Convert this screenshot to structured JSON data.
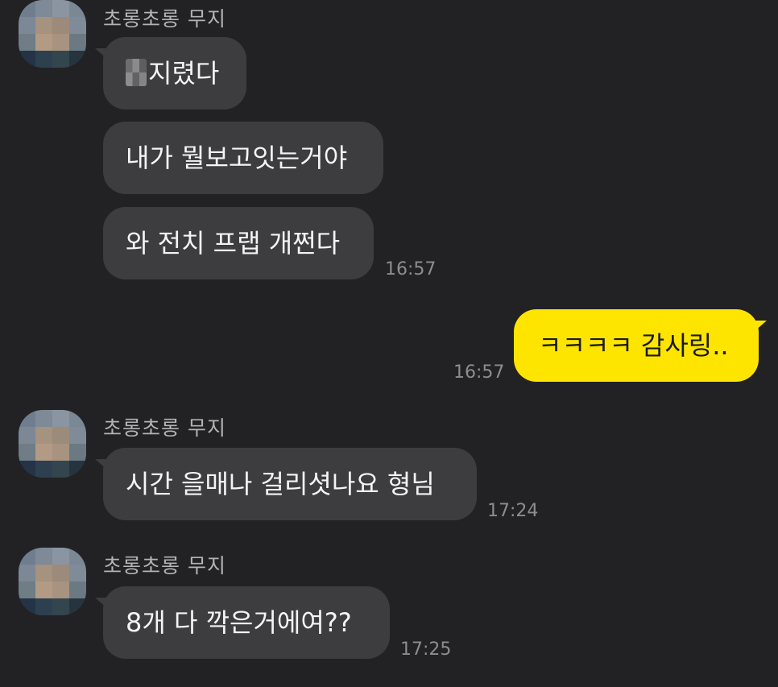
{
  "sender_name": "초롱초롱 무지",
  "groups": [
    {
      "messages": [
        {
          "text": "지렸다",
          "redacted_prefix": true
        },
        {
          "text": "내가 뭘보고잇는거야"
        },
        {
          "text": "와 전치 프랩 개쩐다",
          "time": "16:57"
        }
      ]
    },
    {
      "messages": [
        {
          "text": "시간 을매나 걸리셧나요 형님",
          "time": "17:24"
        }
      ]
    },
    {
      "messages": [
        {
          "text": "8개 다 깍은거에여??",
          "time": "17:25"
        }
      ]
    }
  ],
  "my_message": {
    "text": "ㅋㅋㅋㅋ 감사링..",
    "time": "16:57"
  },
  "colors": {
    "background": "#222224",
    "incoming_bubble": "#3d3d3f",
    "outgoing_bubble": "#fee500",
    "sender_text": "#b3b3b3",
    "timestamp": "#8d8d8f"
  }
}
